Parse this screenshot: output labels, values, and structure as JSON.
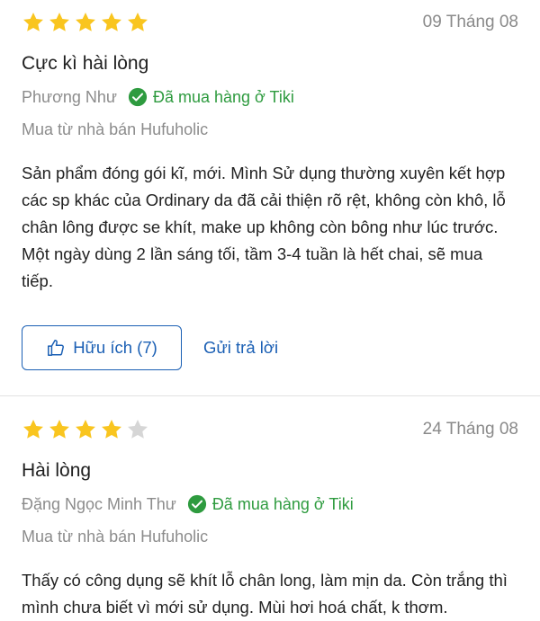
{
  "reviews": [
    {
      "rating": 5,
      "max_rating": 5,
      "date": "09 Tháng 08",
      "title": "Cực kì hài lòng",
      "author": "Phương Như",
      "verified_label": "Đã mua hàng ở Tiki",
      "seller": "Mua từ nhà bán Hufuholic",
      "content": "Sản phẩm đóng gói kĩ, mới. Mình Sử dụng thường xuyên kết hợp các sp khác của Ordinary da đã cải thiện rõ rệt, không còn khô, lỗ chân lông được se khít, make up không còn bông như lúc trước. Một ngày dùng 2 lần sáng tối, tầm 3-4 tuần là hết chai, sẽ mua tiếp.",
      "helpful_label": "Hữu ích (7)",
      "reply_label": "Gửi trả lời"
    },
    {
      "rating": 4,
      "max_rating": 5,
      "date": "24 Tháng 08",
      "title": "Hài lòng",
      "author": "Đặng Ngọc Minh Thư",
      "verified_label": "Đã mua hàng ở Tiki",
      "seller": "Mua từ nhà bán Hufuholic",
      "content": "Thấy có công dụng sẽ khít lỗ chân long, làm mịn da. Còn trắng thì mình chưa biết vì mới sử dụng. Mùi hơi hoá chất, k thơm."
    }
  ],
  "colors": {
    "star_filled": "#f9c51f",
    "star_empty": "#d6d6d6",
    "verified_green": "#2e9b3f",
    "link_blue": "#1a5fb4"
  },
  "icons": {
    "star": "star-icon",
    "verified": "check-circle-icon",
    "helpful": "thumbs-up-icon"
  }
}
